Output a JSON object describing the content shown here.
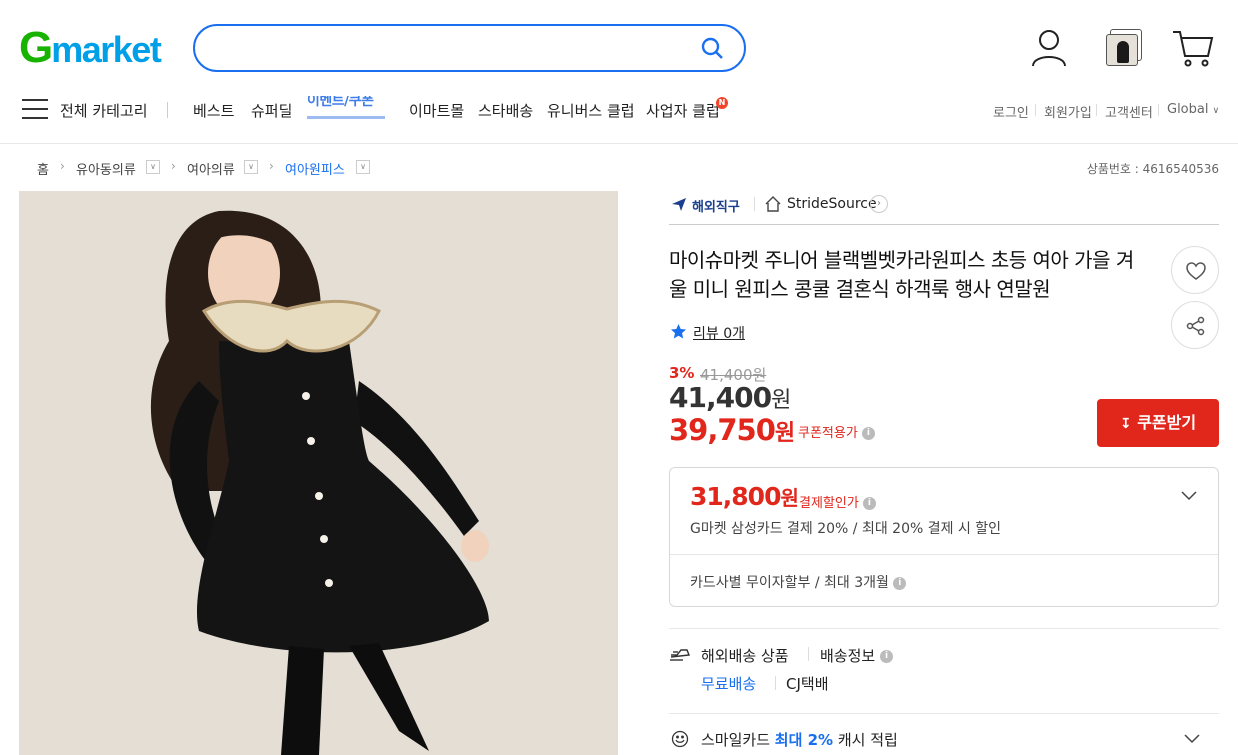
{
  "header": {
    "logo_text_g": "G",
    "logo_text_rest": "market",
    "search_placeholder": ""
  },
  "nav": {
    "all_category": "전체 카테고리",
    "items": [
      "베스트",
      "슈퍼딜",
      "이마트몰",
      "스타배송",
      "유니버스 클럽",
      "사업자 클럽"
    ],
    "banner_text": "이벤트/쿠폰",
    "new_badge": "N",
    "util": [
      "로그인",
      "회원가입",
      "고객센터",
      "Global"
    ]
  },
  "breadcrumb": {
    "items": [
      "홈",
      "유아동의류",
      "여아의류",
      "여아원피스"
    ],
    "goods_no": "상품번호 : 4616540536"
  },
  "product": {
    "overseas_label": "해외직구",
    "seller": "StrideSource",
    "title": "마이슈마켓 주니어 블랙벨벳카라원피스 초등 여아 가을 겨울 미니 원피스 콩쿨 결혼식 하객룩 행사 연말원",
    "review": "리뷰 0개",
    "discount_rate": "3%",
    "original_price": "41,400원",
    "price": "41,400",
    "price_won": "원",
    "coupon_price": "39,750",
    "coupon_won": "원",
    "coupon_label": "쿠폰적용가",
    "coupon_button": "쿠폰받기",
    "benefit": {
      "price": "31,800",
      "price_won": "원",
      "label": "결제할인가",
      "desc": "G마켓 삼성카드 결제 20% / 최대 20% 결제 시 할인",
      "installment": "카드사별 무이자할부 / 최대 3개월"
    },
    "shipping": {
      "type": "해외배송 상품",
      "info": "배송정보",
      "free": "무료배송",
      "carrier": "CJ택배"
    },
    "smile": {
      "prefix": "스마일카드",
      "highlight": "최대 2%",
      "suffix": "캐시 적립"
    }
  },
  "colors": {
    "brand_blue": "#1a6ff0",
    "sale_red": "#e1261c",
    "logo_green": "#18b300"
  },
  "icons": [
    "search-icon",
    "user-icon",
    "recent-item-icon",
    "cart-icon",
    "menu-icon",
    "plane-icon",
    "home-icon",
    "heart-icon",
    "share-icon",
    "star-icon",
    "download-icon",
    "chevron-down-icon",
    "shipping-icon",
    "smile-icon"
  ]
}
